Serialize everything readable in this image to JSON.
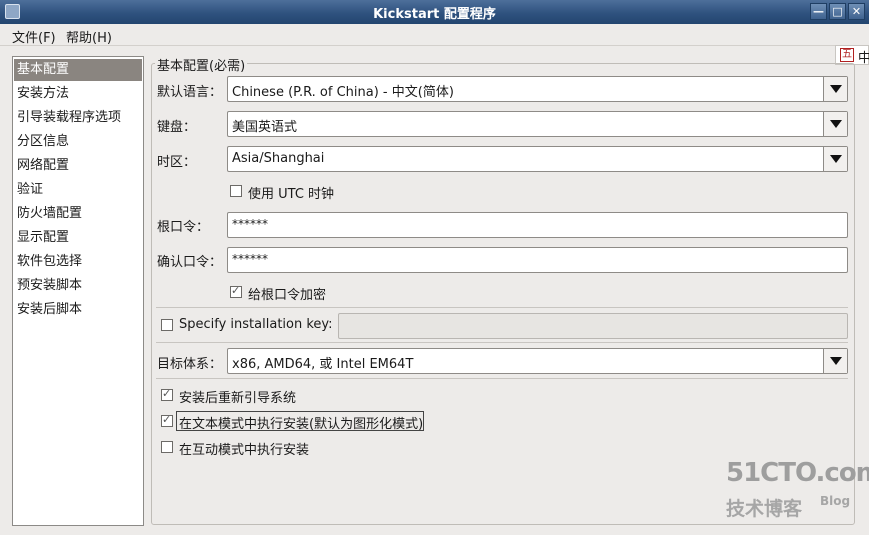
{
  "window": {
    "title": "Kickstart 配置程序",
    "buttons": {
      "minimize": "—",
      "maximize": "□",
      "close": "✕"
    }
  },
  "menubar": {
    "file": "文件(F)",
    "help": "帮助(H)"
  },
  "sidebar": {
    "items": [
      {
        "label": "基本配置"
      },
      {
        "label": "安装方法"
      },
      {
        "label": "引导装载程序选项"
      },
      {
        "label": "分区信息"
      },
      {
        "label": "网络配置"
      },
      {
        "label": "验证"
      },
      {
        "label": "防火墙配置"
      },
      {
        "label": "显示配置"
      },
      {
        "label": "软件包选择"
      },
      {
        "label": "预安装脚本"
      },
      {
        "label": "安装后脚本"
      }
    ]
  },
  "basic": {
    "section_title": "基本配置(必需)",
    "language_label": "默认语言：",
    "language_value": "Chinese (P.R. of China) - 中文(简体)",
    "keyboard_label": "键盘：",
    "keyboard_value": "美国英语式",
    "timezone_label": "时区：",
    "timezone_value": "Asia/Shanghai",
    "utc_label": "使用 UTC 时钟",
    "root_pw_label": "根口令：",
    "root_pw_value": "******",
    "confirm_pw_label": "确认口令：",
    "confirm_pw_value": "******",
    "encrypt_label": "给根口令加密",
    "install_key_label": "Specify installation key:",
    "install_key_value": "",
    "arch_label": "目标体系：",
    "arch_value": "x86, AMD64, 或 Intel EM64T",
    "reboot_label": "安装后重新引导系统",
    "text_mode_label": "在文本模式中执行安装(默认为图形化模式)",
    "interactive_label": "在互动模式中执行安装"
  },
  "ime": {
    "icon": "五",
    "text": "中"
  },
  "watermark": {
    "site": "51CTO.com",
    "sub": "技术博客",
    "blog": "Blog"
  }
}
